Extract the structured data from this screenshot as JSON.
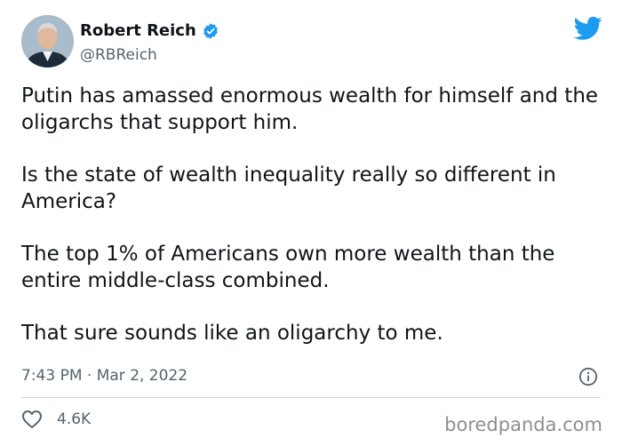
{
  "author": {
    "name": "Robert Reich",
    "handle": "@RBReich",
    "verified": true
  },
  "tweet": {
    "paragraphs": [
      "Putin has amassed enormous wealth for himself and the oligarchs that support him.",
      "Is the state of wealth inequality really so different in America?",
      "The top 1% of Americans own more wealth than the entire middle-class combined.",
      "That sure sounds like an oligarchy to me."
    ],
    "timestamp": "7:43 PM · Mar 2, 2022",
    "likes": "4.6K"
  },
  "watermark": "boredpanda.com",
  "icons": {
    "logo": "twitter-bird-icon",
    "verified": "verified-badge-icon",
    "info": "info-icon",
    "like": "heart-icon"
  },
  "colors": {
    "accent": "#1d9bf0",
    "text": "#0f1419",
    "secondary": "#536471",
    "divider": "#cfd9de"
  }
}
